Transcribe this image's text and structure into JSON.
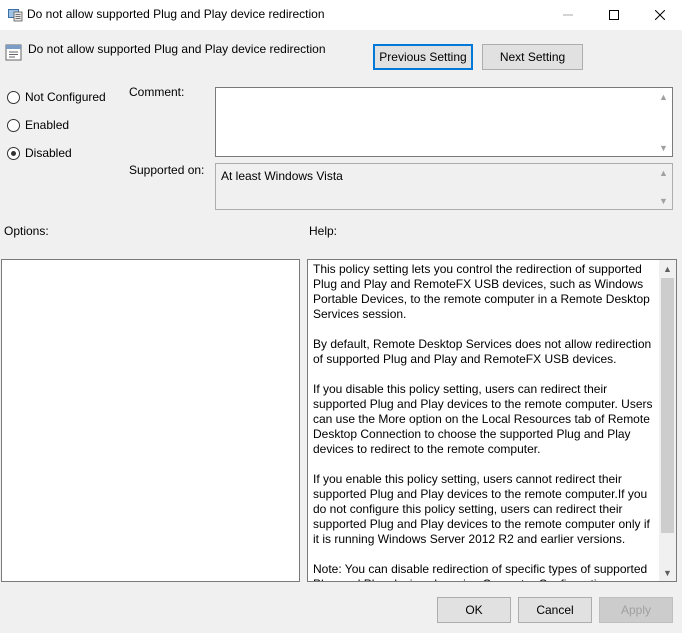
{
  "window": {
    "title": "Do not allow supported Plug and Play device redirection",
    "minimize_glyph": "—",
    "maximize_glyph": "☐",
    "close_glyph": "✕"
  },
  "header": {
    "setting_name": "Do not allow supported Plug and Play device redirection",
    "previous_label": "Previous Setting",
    "next_label": "Next Setting"
  },
  "state": {
    "options": [
      {
        "label": "Not Configured",
        "selected": false
      },
      {
        "label": "Enabled",
        "selected": false
      },
      {
        "label": "Disabled",
        "selected": true
      }
    ]
  },
  "comment": {
    "label": "Comment:",
    "value": ""
  },
  "supported": {
    "label": "Supported on:",
    "value": "At least Windows Vista"
  },
  "options_pane": {
    "label": "Options:"
  },
  "help_pane": {
    "label": "Help:",
    "paragraphs": [
      "This policy setting lets you control the redirection of supported Plug and Play and RemoteFX USB devices, such as Windows Portable Devices, to the remote computer in a Remote Desktop Services session.",
      "By default, Remote Desktop Services does not allow redirection of supported Plug and Play and RemoteFX USB devices.",
      "If you disable this policy setting, users can redirect their supported Plug and Play devices to the remote computer. Users can use the More option on the Local Resources tab of Remote Desktop Connection to choose the supported Plug and Play devices to redirect to the remote computer.",
      "If you enable this policy setting, users cannot redirect their supported Plug and Play devices to the remote computer.If you do not configure this policy setting, users can redirect their supported Plug and Play devices to the remote computer only if it is running Windows Server 2012 R2 and earlier versions.",
      "Note: You can disable redirection of specific types of supported Plug and Play devices by using Computer Configuration"
    ]
  },
  "footer": {
    "ok_label": "OK",
    "cancel_label": "Cancel",
    "apply_label": "Apply"
  },
  "colors": {
    "focus_border": "#0078d7",
    "dialog_bg": "#f0f0f0"
  }
}
